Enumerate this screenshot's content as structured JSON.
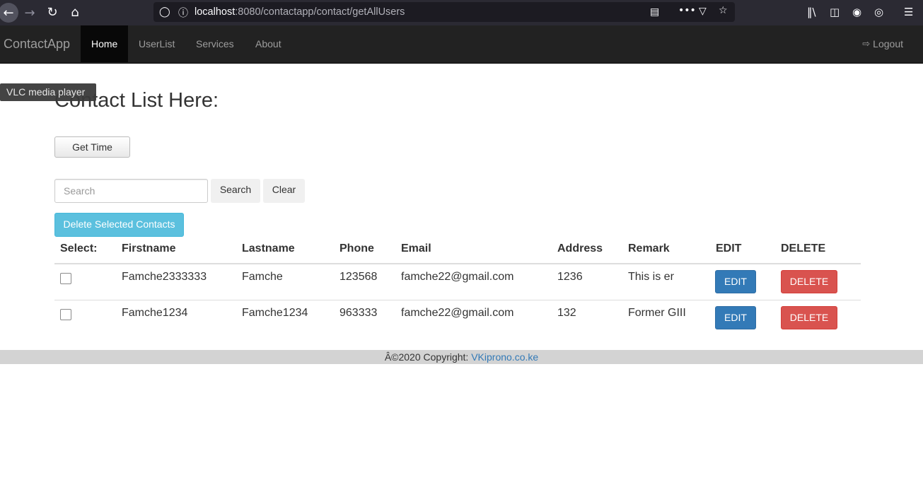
{
  "browser": {
    "url_host": "localhost",
    "url_rest": ":8080/contactapp/contact/getAllUsers"
  },
  "navbar": {
    "brand": "ContactApp",
    "items": [
      {
        "label": "Home",
        "active": true
      },
      {
        "label": "UserList",
        "active": false
      },
      {
        "label": "Services",
        "active": false
      },
      {
        "label": "About",
        "active": false
      }
    ],
    "logout_label": "Logout"
  },
  "tooltip": "VLC media player",
  "page_title": "Contact List Here:",
  "get_time_label": "Get Time",
  "search": {
    "placeholder": "Search",
    "search_label": "Search",
    "clear_label": "Clear"
  },
  "delete_selected_label": "Delete Selected Contacts",
  "table": {
    "headers": [
      "Select:",
      "Firstname",
      "Lastname",
      "Phone",
      "Email",
      "Address",
      "Remark",
      "EDIT",
      "DELETE"
    ],
    "rows": [
      {
        "firstname": "Famche2333333",
        "lastname": "Famche",
        "phone": "123568",
        "email": "famche22@gmail.com",
        "address": "1236",
        "remark": "This is er",
        "edit": "EDIT",
        "delete": "DELETE"
      },
      {
        "firstname": "Famche1234",
        "lastname": "Famche1234",
        "phone": "963333",
        "email": "famche22@gmail.com",
        "address": "132",
        "remark": "Former GIII",
        "edit": "EDIT",
        "delete": "DELETE"
      }
    ]
  },
  "footer": {
    "text": "Â©2020 Copyright: ",
    "link": "VKiprono.co.ke"
  }
}
